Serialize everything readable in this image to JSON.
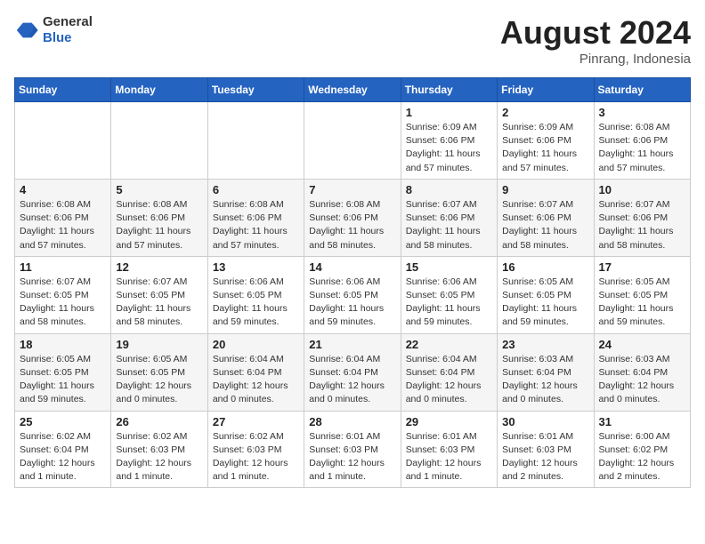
{
  "header": {
    "logo_general": "General",
    "logo_blue": "Blue",
    "month_title": "August 2024",
    "location": "Pinrang, Indonesia"
  },
  "days_of_week": [
    "Sunday",
    "Monday",
    "Tuesday",
    "Wednesday",
    "Thursday",
    "Friday",
    "Saturday"
  ],
  "weeks": [
    [
      {
        "day": "",
        "info": ""
      },
      {
        "day": "",
        "info": ""
      },
      {
        "day": "",
        "info": ""
      },
      {
        "day": "",
        "info": ""
      },
      {
        "day": "1",
        "info": "Sunrise: 6:09 AM\nSunset: 6:06 PM\nDaylight: 11 hours and 57 minutes."
      },
      {
        "day": "2",
        "info": "Sunrise: 6:09 AM\nSunset: 6:06 PM\nDaylight: 11 hours and 57 minutes."
      },
      {
        "day": "3",
        "info": "Sunrise: 6:08 AM\nSunset: 6:06 PM\nDaylight: 11 hours and 57 minutes."
      }
    ],
    [
      {
        "day": "4",
        "info": "Sunrise: 6:08 AM\nSunset: 6:06 PM\nDaylight: 11 hours and 57 minutes."
      },
      {
        "day": "5",
        "info": "Sunrise: 6:08 AM\nSunset: 6:06 PM\nDaylight: 11 hours and 57 minutes."
      },
      {
        "day": "6",
        "info": "Sunrise: 6:08 AM\nSunset: 6:06 PM\nDaylight: 11 hours and 57 minutes."
      },
      {
        "day": "7",
        "info": "Sunrise: 6:08 AM\nSunset: 6:06 PM\nDaylight: 11 hours and 58 minutes."
      },
      {
        "day": "8",
        "info": "Sunrise: 6:07 AM\nSunset: 6:06 PM\nDaylight: 11 hours and 58 minutes."
      },
      {
        "day": "9",
        "info": "Sunrise: 6:07 AM\nSunset: 6:06 PM\nDaylight: 11 hours and 58 minutes."
      },
      {
        "day": "10",
        "info": "Sunrise: 6:07 AM\nSunset: 6:06 PM\nDaylight: 11 hours and 58 minutes."
      }
    ],
    [
      {
        "day": "11",
        "info": "Sunrise: 6:07 AM\nSunset: 6:05 PM\nDaylight: 11 hours and 58 minutes."
      },
      {
        "day": "12",
        "info": "Sunrise: 6:07 AM\nSunset: 6:05 PM\nDaylight: 11 hours and 58 minutes."
      },
      {
        "day": "13",
        "info": "Sunrise: 6:06 AM\nSunset: 6:05 PM\nDaylight: 11 hours and 59 minutes."
      },
      {
        "day": "14",
        "info": "Sunrise: 6:06 AM\nSunset: 6:05 PM\nDaylight: 11 hours and 59 minutes."
      },
      {
        "day": "15",
        "info": "Sunrise: 6:06 AM\nSunset: 6:05 PM\nDaylight: 11 hours and 59 minutes."
      },
      {
        "day": "16",
        "info": "Sunrise: 6:05 AM\nSunset: 6:05 PM\nDaylight: 11 hours and 59 minutes."
      },
      {
        "day": "17",
        "info": "Sunrise: 6:05 AM\nSunset: 6:05 PM\nDaylight: 11 hours and 59 minutes."
      }
    ],
    [
      {
        "day": "18",
        "info": "Sunrise: 6:05 AM\nSunset: 6:05 PM\nDaylight: 11 hours and 59 minutes."
      },
      {
        "day": "19",
        "info": "Sunrise: 6:05 AM\nSunset: 6:05 PM\nDaylight: 12 hours and 0 minutes."
      },
      {
        "day": "20",
        "info": "Sunrise: 6:04 AM\nSunset: 6:04 PM\nDaylight: 12 hours and 0 minutes."
      },
      {
        "day": "21",
        "info": "Sunrise: 6:04 AM\nSunset: 6:04 PM\nDaylight: 12 hours and 0 minutes."
      },
      {
        "day": "22",
        "info": "Sunrise: 6:04 AM\nSunset: 6:04 PM\nDaylight: 12 hours and 0 minutes."
      },
      {
        "day": "23",
        "info": "Sunrise: 6:03 AM\nSunset: 6:04 PM\nDaylight: 12 hours and 0 minutes."
      },
      {
        "day": "24",
        "info": "Sunrise: 6:03 AM\nSunset: 6:04 PM\nDaylight: 12 hours and 0 minutes."
      }
    ],
    [
      {
        "day": "25",
        "info": "Sunrise: 6:02 AM\nSunset: 6:04 PM\nDaylight: 12 hours and 1 minute."
      },
      {
        "day": "26",
        "info": "Sunrise: 6:02 AM\nSunset: 6:03 PM\nDaylight: 12 hours and 1 minute."
      },
      {
        "day": "27",
        "info": "Sunrise: 6:02 AM\nSunset: 6:03 PM\nDaylight: 12 hours and 1 minute."
      },
      {
        "day": "28",
        "info": "Sunrise: 6:01 AM\nSunset: 6:03 PM\nDaylight: 12 hours and 1 minute."
      },
      {
        "day": "29",
        "info": "Sunrise: 6:01 AM\nSunset: 6:03 PM\nDaylight: 12 hours and 1 minute."
      },
      {
        "day": "30",
        "info": "Sunrise: 6:01 AM\nSunset: 6:03 PM\nDaylight: 12 hours and 2 minutes."
      },
      {
        "day": "31",
        "info": "Sunrise: 6:00 AM\nSunset: 6:02 PM\nDaylight: 12 hours and 2 minutes."
      }
    ]
  ]
}
